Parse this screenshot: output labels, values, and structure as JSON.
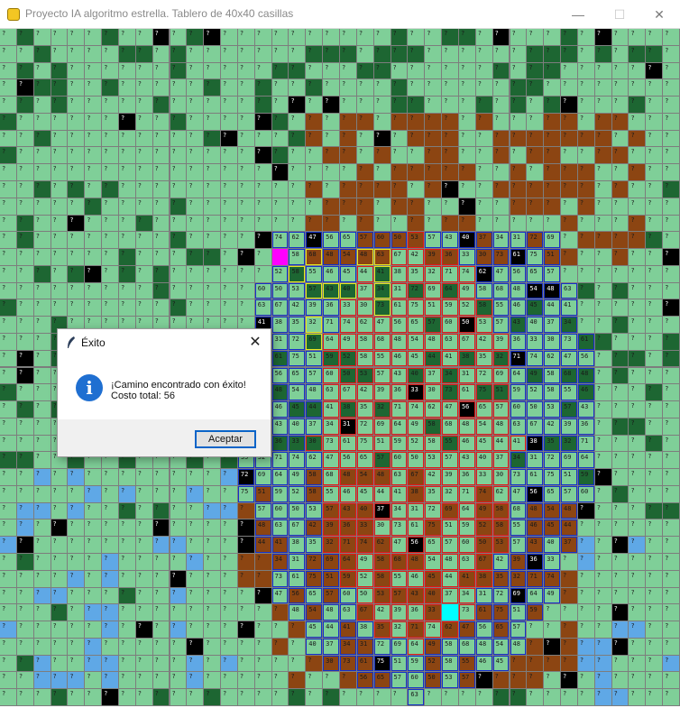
{
  "window": {
    "title": "Proyecto IA algoritmo estrella. Tablero de 40x40 casillas",
    "minimize_glyph": "—",
    "maximize_glyph": "☐",
    "close_glyph": "✕",
    "app_icon": "python-icon"
  },
  "board": {
    "rows": 40,
    "cols": 40,
    "unknown_label": "?",
    "colors": {
      "light_green": "#7fcf98",
      "dark_green": "#1d6632",
      "brown": "#8c4512",
      "black": "#000000",
      "light_blue": "#5fa8e6",
      "explored_blue_border": "#1530c8",
      "path_red_border": "#e01818",
      "frontier_yellow_border": "#e8e820",
      "goal_cyan": "#00ffff",
      "start_magenta": "#ff00ff",
      "grid_line": "#7d7d7d"
    },
    "visible_costs": [
      "56",
      "58",
      "59",
      "65",
      "68",
      "52",
      "57",
      "48",
      "58",
      "60",
      "54",
      "55",
      "50",
      "48",
      "46",
      "53",
      "63",
      "45",
      "57",
      "67",
      "44",
      "43",
      "42",
      "41",
      "40",
      "39",
      "38",
      "37",
      "36",
      "35",
      "34",
      "33",
      "32",
      "31",
      "30",
      "71",
      "72",
      "73",
      "74",
      "69",
      "61",
      "62",
      "64",
      "75",
      "47",
      "49",
      "51"
    ]
  },
  "dialog": {
    "title": "Éxito",
    "title_icon": "feather-icon",
    "close_glyph": "✕",
    "icon": "info-icon",
    "icon_glyph": "i",
    "message_line1": "¡Camino encontrado con éxito!",
    "message_line2": "Costo total: 56",
    "ok_label": "Aceptar"
  }
}
